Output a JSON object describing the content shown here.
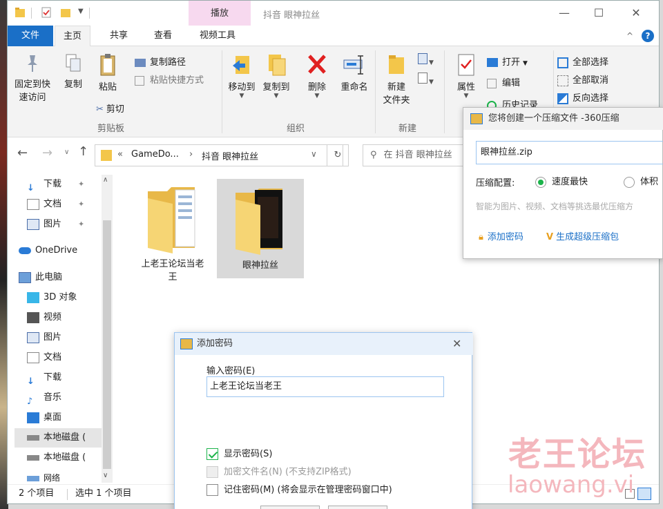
{
  "window": {
    "title": "抖音 眼神拉丝",
    "context_tab": "播放",
    "controls": {
      "minimize": "—",
      "maximize": "☐",
      "close": "✕"
    }
  },
  "ribbon_tabs": [
    "文件",
    "主页",
    "共享",
    "查看",
    "视频工具"
  ],
  "ribbon": {
    "pin_label1": "固定到快",
    "pin_label2": "速访问",
    "copy": "复制",
    "paste": "粘贴",
    "copy_path": "复制路径",
    "paste_shortcut": "粘贴快捷方式",
    "cut": "剪切",
    "group_clipboard": "剪贴板",
    "move_to": "移动到",
    "copy_to": "复制到",
    "delete": "删除",
    "rename": "重命名",
    "group_organize": "组织",
    "new_folder1": "新建",
    "new_folder2": "文件夹",
    "group_new": "新建",
    "properties": "属性",
    "open": "打开",
    "edit": "编辑",
    "history": "历史记录",
    "select_all": "全部选择",
    "select_none": "全部取消",
    "invert": "反向选择"
  },
  "address": {
    "path": [
      "«",
      "GameDo...",
      "›",
      "抖音 眼神拉丝"
    ],
    "search_placeholder": "在 抖音 眼神拉丝"
  },
  "nav": [
    {
      "label": "下载",
      "pin": true
    },
    {
      "label": "文档",
      "pin": true
    },
    {
      "label": "图片",
      "pin": true
    },
    {
      "label": "OneDrive"
    },
    {
      "label": "此电脑"
    },
    {
      "label": "3D 对象"
    },
    {
      "label": "视频"
    },
    {
      "label": "图片"
    },
    {
      "label": "文档"
    },
    {
      "label": "下载"
    },
    {
      "label": "音乐"
    },
    {
      "label": "桌面"
    },
    {
      "label": "本地磁盘 ("
    },
    {
      "label": "本地磁盘 ("
    },
    {
      "label": "网络"
    }
  ],
  "files": [
    {
      "name_line1": "上老王论坛当老",
      "name_line2": "王"
    },
    {
      "name_line1": "眼神拉丝",
      "name_line2": ""
    }
  ],
  "status": {
    "count": "2 个项目",
    "selected": "选中 1 个项目"
  },
  "zip_dialog": {
    "title": "您将创建一个压缩文件 -360压缩",
    "filename": "眼神拉丝.zip",
    "config_label": "压缩配置:",
    "option_fast": "速度最快",
    "option_small": "体积",
    "hint": "智能为图片、视频、文档等挑选最优压缩方",
    "add_password": "添加密码",
    "super_zip": "生成超级压缩包"
  },
  "password_dialog": {
    "title": "添加密码",
    "input_label": "输入密码(E)",
    "password": "上老王论坛当老王",
    "show_password": "显示密码(S)",
    "encrypt_names": "加密文件名(N) (不支持ZIP格式)",
    "remember": "记住密码(M) (将会显示在管理密码窗口中)"
  },
  "watermark": {
    "line1": "老王论坛",
    "line2": "laowang.vi"
  },
  "colors": {
    "file_tab": "#1a6fc7",
    "context_tab": "#f7d9ef",
    "green": "#1bb34a",
    "link": "#1a6fc7"
  }
}
